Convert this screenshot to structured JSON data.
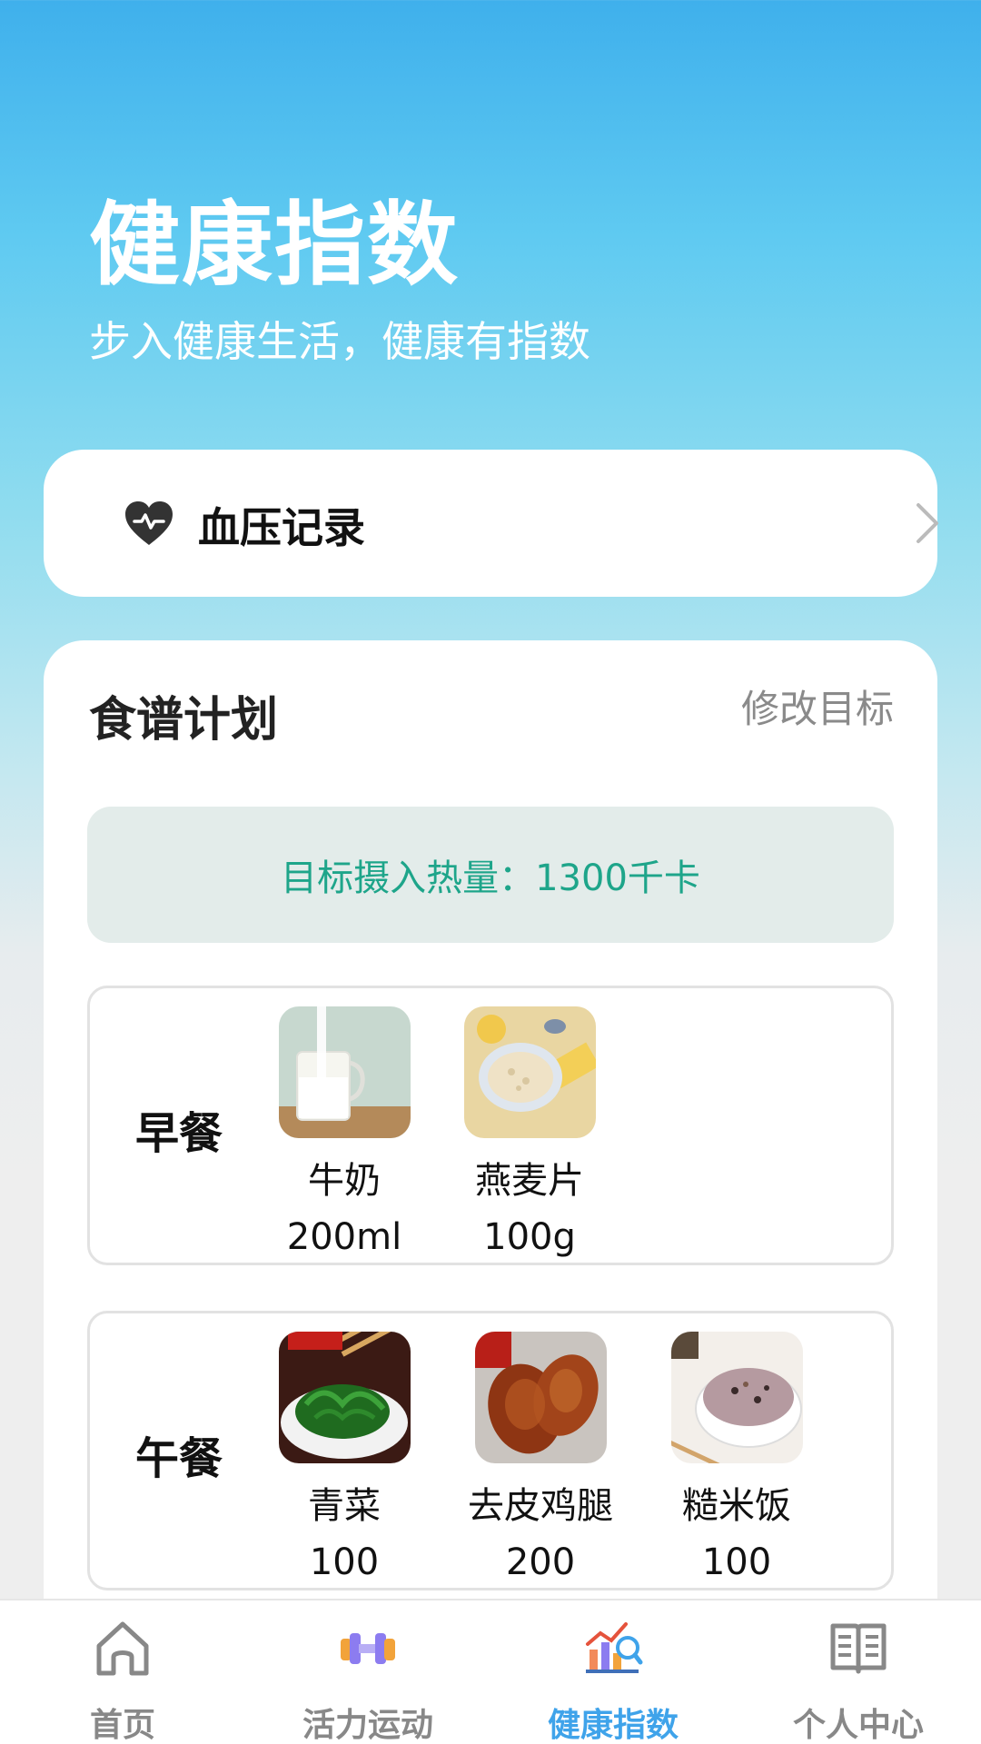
{
  "header": {
    "title": "健康指数",
    "subtitle": "步入健康生活，健康有指数"
  },
  "blood_pressure": {
    "label": "血压记录",
    "icon": "heart-icon"
  },
  "recipe": {
    "title": "食谱计划",
    "edit_label": "修改目标",
    "target_text": "目标摄入热量：1300千卡",
    "meals": [
      {
        "name": "早餐",
        "foods": [
          {
            "name": "牛奶",
            "amount": "200ml"
          },
          {
            "name": "燕麦片",
            "amount": "100g"
          }
        ]
      },
      {
        "name": "午餐",
        "foods": [
          {
            "name": "青菜",
            "amount": "100"
          },
          {
            "name": "去皮鸡腿",
            "amount": "200"
          },
          {
            "name": "糙米饭",
            "amount": "100"
          }
        ]
      }
    ]
  },
  "tabbar": {
    "items": [
      {
        "label": "首页",
        "icon": "home-icon",
        "active": false
      },
      {
        "label": "活力运动",
        "icon": "dumbbell-icon",
        "active": false
      },
      {
        "label": "健康指数",
        "icon": "chart-icon",
        "active": true
      },
      {
        "label": "个人中心",
        "icon": "book-icon",
        "active": false
      }
    ]
  },
  "colors": {
    "accent": "#3fa3ea",
    "target_text": "#1ea58a",
    "target_bg": "#e3ecea"
  }
}
